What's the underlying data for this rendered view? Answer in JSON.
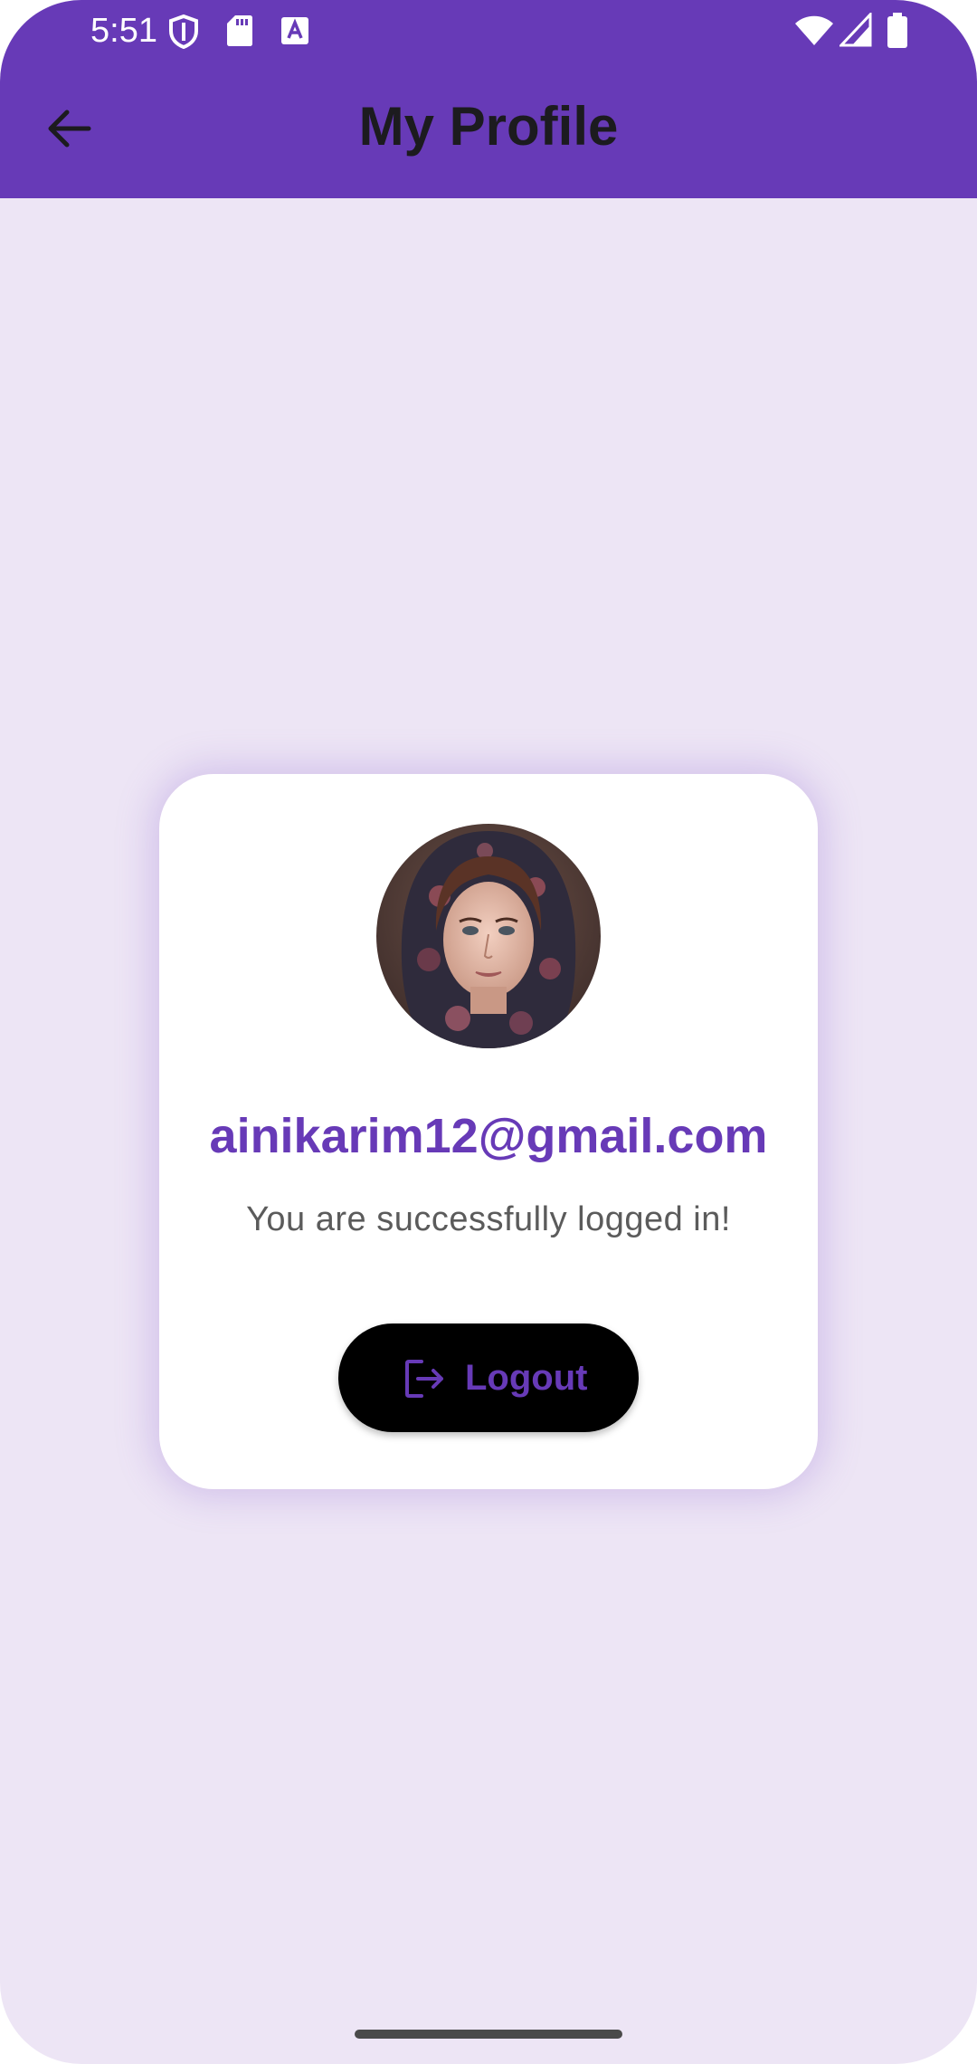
{
  "status_bar": {
    "time": "5:51",
    "left_icons": [
      "shield-icon",
      "sd-card-icon",
      "font-a-icon"
    ],
    "right_icons": [
      "wifi-icon",
      "signal-icon",
      "battery-icon"
    ]
  },
  "app_bar": {
    "title": "My Profile",
    "back_icon": "arrow-back-icon"
  },
  "profile_card": {
    "avatar": "profile-photo",
    "email": "ainikarim12@gmail.com",
    "message": "You are successfully logged in!",
    "logout_button": {
      "icon": "logout-icon",
      "label": "Logout"
    }
  },
  "colors": {
    "primary": "#673ab7",
    "background": "#ede5f5",
    "card": "#ffffff",
    "button": "#000000",
    "title_text": "#1c1b1f",
    "message_text": "#5b5b5b"
  }
}
